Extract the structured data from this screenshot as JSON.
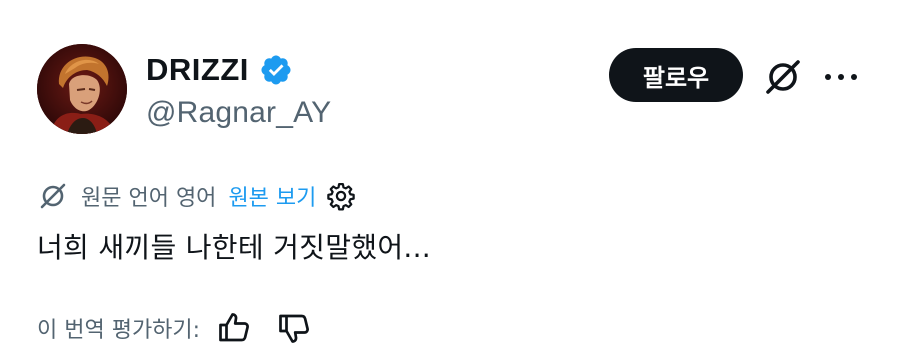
{
  "user": {
    "display_name": "DRIZZI",
    "handle": "@Ragnar_AY",
    "verified": true,
    "verified_color": "#1d9bf0"
  },
  "actions": {
    "follow_label": "팔로우",
    "grok_icon": "grok-slash-icon",
    "more_icon": "more-dots-icon"
  },
  "translation": {
    "label": "원문 언어 영어",
    "view_original": "원본 보기",
    "settings_icon": "gear-icon"
  },
  "tweet": {
    "text": "너희 새끼들 나한테 거짓말했어..."
  },
  "rating": {
    "label": "이 번역 평가하기:",
    "thumb_up_icon": "thumb-up-icon",
    "thumb_down_icon": "thumb-down-icon"
  },
  "colors": {
    "text": "#0f1419",
    "secondary": "#536471",
    "accent": "#1d9bf0",
    "button_bg": "#0f1419"
  }
}
